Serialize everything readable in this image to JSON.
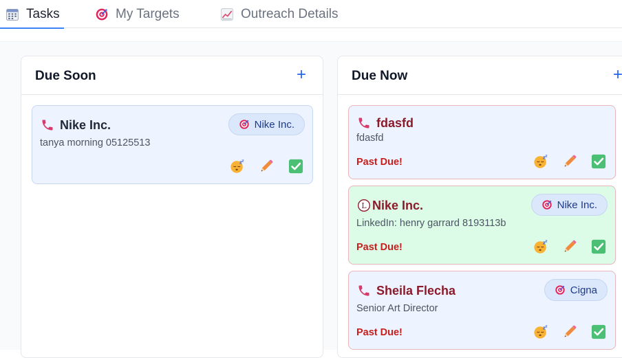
{
  "tabs": [
    {
      "label": "Tasks",
      "icon": "calendar-icon",
      "active": true
    },
    {
      "label": "My Targets",
      "icon": "target-icon",
      "active": false
    },
    {
      "label": "Outreach Details",
      "icon": "chart-icon",
      "active": false
    }
  ],
  "columns": [
    {
      "title": "Due Soon",
      "add_label": "+",
      "cards": [
        {
          "icon": "phone-icon",
          "title": "Nike Inc.",
          "subtitle": "tanya morning 05125513",
          "tag": "Nike Inc.",
          "status": ""
        }
      ]
    },
    {
      "title": "Due Now",
      "add_label": "+",
      "cards": [
        {
          "icon": "phone-icon",
          "title": "fdasfd",
          "subtitle": "fdasfd",
          "tag": "",
          "status": "Past Due!"
        },
        {
          "icon": "linkedin-icon",
          "lead_glyph": "L",
          "title": "Nike Inc.",
          "subtitle": "LinkedIn: henry garrard 8193113b",
          "tag": "Nike Inc.",
          "status": "Past Due!"
        },
        {
          "icon": "phone-icon",
          "title": "Sheila Flecha",
          "subtitle": "Senior Art Director",
          "tag": "Cigna",
          "status": "Past Due!"
        }
      ]
    }
  ],
  "colors": {
    "accent": "#2563eb",
    "past_due": "#c81e1e",
    "title_overdue": "#8b1a2b",
    "card_blue": "#eef4ff",
    "card_green": "#dcfce7"
  }
}
